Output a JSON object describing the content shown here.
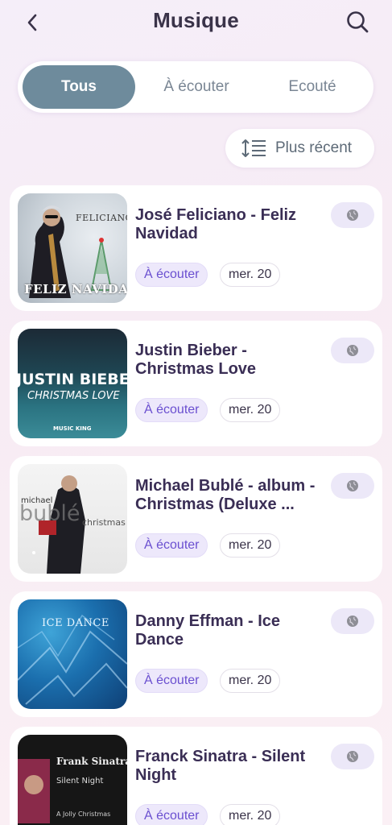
{
  "header": {
    "title": "Musique",
    "back_icon": "chevron-left-icon",
    "search_icon": "search-icon"
  },
  "tabs": [
    {
      "label": "Tous",
      "active": true
    },
    {
      "label": "À écouter",
      "active": false
    },
    {
      "label": "Ecouté",
      "active": false
    }
  ],
  "sort": {
    "label": "Plus récent",
    "icon": "sort-lines-icon"
  },
  "colors": {
    "accent": "#6e8b9c",
    "chip_text": "#6a4fd0",
    "title_text": "#3a2e55"
  },
  "items": [
    {
      "title": "José Feliciano - Feliz Navidad",
      "status": "À écouter",
      "date": "mer. 20",
      "globe_icon": "globe-icon",
      "cover": {
        "line1": "FELICIANO",
        "line2": "FELIZ NAVIDAD"
      }
    },
    {
      "title": "Justin Bieber - Christmas Love",
      "status": "À écouter",
      "date": "mer. 20",
      "globe_icon": "globe-icon",
      "cover": {
        "line1": "JUSTIN BIEBER",
        "line2": "CHRISTMAS LOVE",
        "line3": "MUSIC KING"
      }
    },
    {
      "title": "Michael Bublé - album - Christmas (Deluxe ...",
      "status": "À écouter",
      "date": "mer. 20",
      "globe_icon": "globe-icon",
      "cover": {
        "line1": "michael",
        "line2": "bublé",
        "line3": "christmas"
      }
    },
    {
      "title": "Danny Effman - Ice Dance",
      "status": "À écouter",
      "date": "mer. 20",
      "globe_icon": "globe-icon",
      "cover": {
        "line1": "ICE DANCE"
      }
    },
    {
      "title": "Franck Sinatra - Silent Night",
      "status": "À écouter",
      "date": "mer. 20",
      "globe_icon": "globe-icon",
      "cover": {
        "line1": "Frank Sinatra",
        "line2": "Silent Night",
        "line3": "A Jolly Christmas"
      }
    }
  ]
}
